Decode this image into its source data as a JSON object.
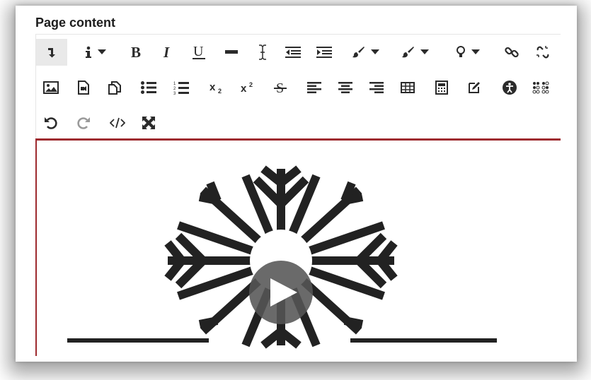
{
  "page": {
    "title": "Page content"
  },
  "toolbar": {
    "rows": [
      [
        "paragraph-type",
        "info",
        "bold",
        "italic",
        "underline",
        "horizontal-rule",
        "clear-formatting",
        "outdent",
        "indent",
        "text-color",
        "background-color",
        "lightbulb",
        "link",
        "unlink"
      ],
      [
        "image",
        "media",
        "copy",
        "bullet-list",
        "numbered-list",
        "subscript",
        "superscript",
        "strikethrough",
        "align-left",
        "align-center",
        "align-right",
        "table",
        "calculator",
        "edit",
        "accessibility",
        "braille"
      ],
      [
        "undo",
        "redo",
        "html-source",
        "fullscreen"
      ]
    ]
  },
  "editor": {
    "media": "video-thumbnail"
  },
  "colors": {
    "editor_border": "#9e2a2f",
    "icon": "#2b2b2b",
    "disabled_icon": "#9a9a9a"
  }
}
